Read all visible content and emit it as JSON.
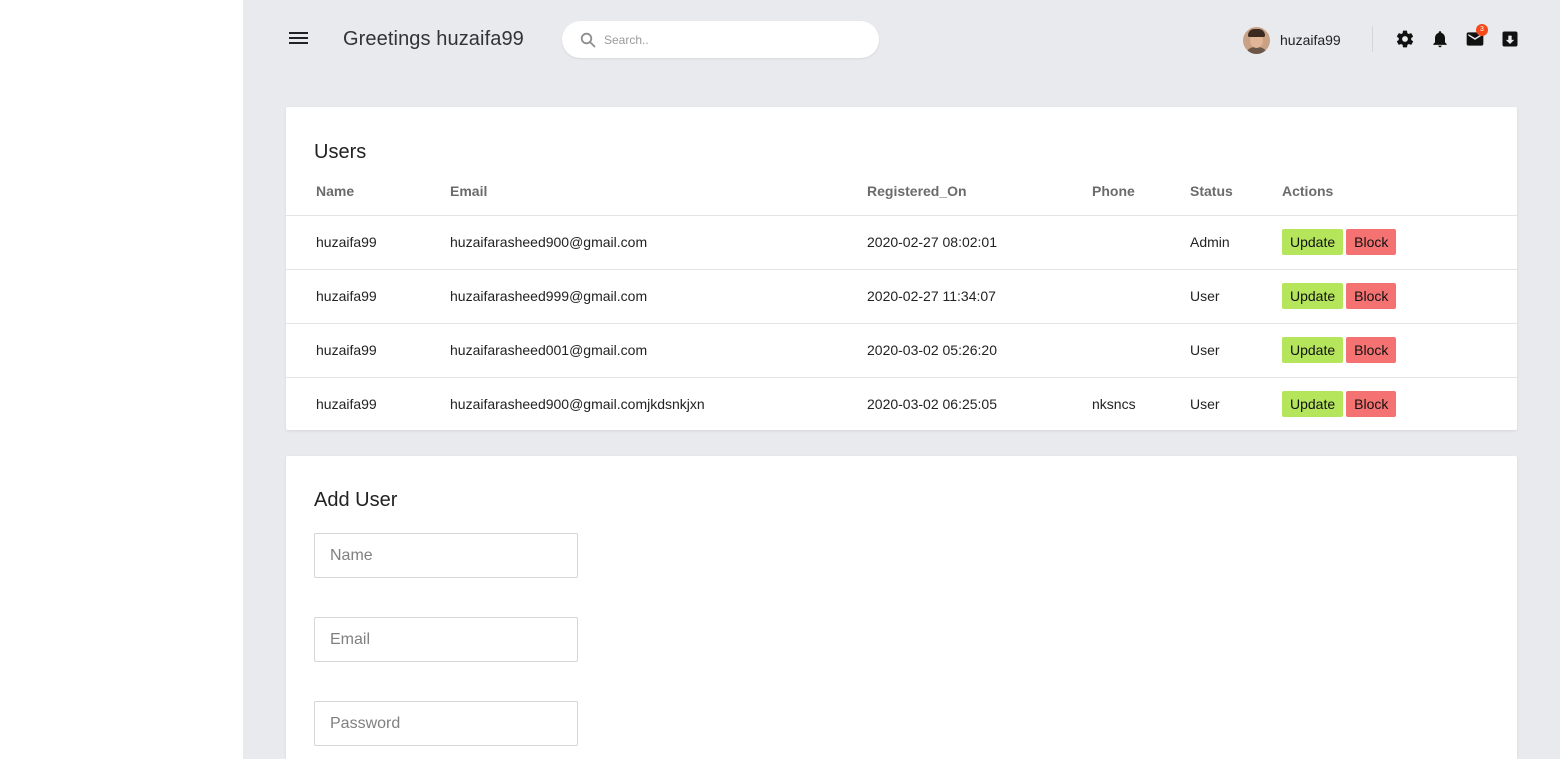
{
  "header": {
    "greeting": "Greetings huzaifa99",
    "search_placeholder": "Search..",
    "username": "huzaifa99",
    "mail_badge": "3"
  },
  "users_card": {
    "title": "Users",
    "columns": [
      "Name",
      "Email",
      "Registered_On",
      "Phone",
      "Status",
      "Actions"
    ],
    "rows": [
      {
        "name": "huzaifa99",
        "email": "huzaifarasheed900@gmail.com",
        "registered_on": "2020-02-27 08:02:01",
        "phone": "",
        "status": "Admin",
        "update": "Update",
        "block": "Block"
      },
      {
        "name": "huzaifa99",
        "email": "huzaifarasheed999@gmail.com",
        "registered_on": "2020-02-27 11:34:07",
        "phone": "",
        "status": "User",
        "update": "Update",
        "block": "Block"
      },
      {
        "name": "huzaifa99",
        "email": "huzaifarasheed001@gmail.com",
        "registered_on": "2020-03-02 05:26:20",
        "phone": "",
        "status": "User",
        "update": "Update",
        "block": "Block"
      },
      {
        "name": "huzaifa99",
        "email": "huzaifarasheed900@gmail.comjkdsnkjxn",
        "registered_on": "2020-03-02 06:25:05",
        "phone": "nksncs",
        "status": "User",
        "update": "Update",
        "block": "Block"
      }
    ]
  },
  "add_user_card": {
    "title": "Add User",
    "name_placeholder": "Name",
    "email_placeholder": "Email",
    "password_placeholder": "Password"
  },
  "colors": {
    "background": "#e9eaee",
    "update_button": "#b5e55b",
    "block_button": "#f47272",
    "badge": "#f44a1a"
  },
  "icons": [
    "menu-icon",
    "search-icon",
    "gear-icon",
    "bell-icon",
    "mail-icon",
    "download-icon"
  ]
}
